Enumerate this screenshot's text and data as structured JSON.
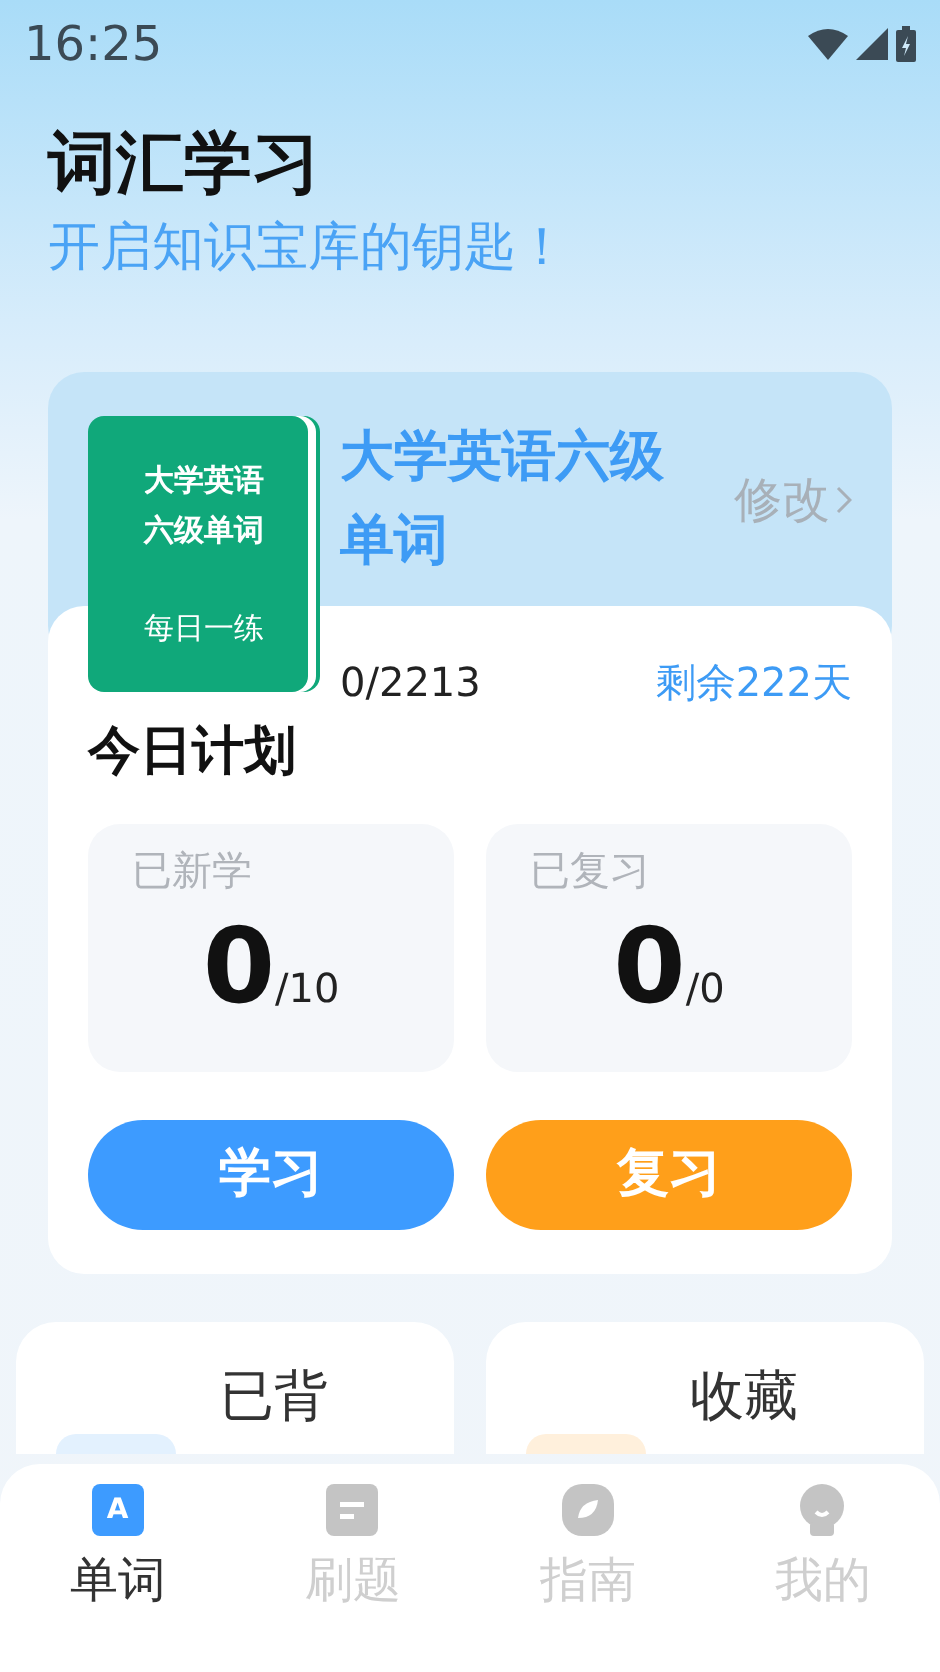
{
  "status_bar": {
    "time": "16:25"
  },
  "header": {
    "title": "词汇学习",
    "subtitle": "开启知识宝库的钥匙！"
  },
  "book": {
    "cover_lines": [
      "大学英语",
      "六级单词"
    ],
    "cover_footer": "每日一练",
    "title": "大学英语六级单词",
    "edit_link": "修改",
    "progress": "0/2213",
    "remaining": "剩余222天"
  },
  "plan": {
    "title": "今日计划",
    "stats": [
      {
        "label": "已新学",
        "value": "0",
        "total": "/10"
      },
      {
        "label": "已复习",
        "value": "0",
        "total": "/0"
      }
    ],
    "buttons": [
      {
        "label": "学习",
        "kind": "learn"
      },
      {
        "label": "复习",
        "kind": "review"
      }
    ]
  },
  "shortcuts": [
    {
      "label": "已背",
      "color": "#e3f1fe"
    },
    {
      "label": "收藏",
      "color": "#fff0dc"
    }
  ],
  "tabs": [
    {
      "label": "单词",
      "kind": "letter",
      "icon_letter": "A",
      "selected": true
    },
    {
      "label": "刷题",
      "kind": "note",
      "selected": false
    },
    {
      "label": "指南",
      "kind": "compass",
      "selected": false
    },
    {
      "label": "我的",
      "kind": "person",
      "selected": false
    }
  ]
}
